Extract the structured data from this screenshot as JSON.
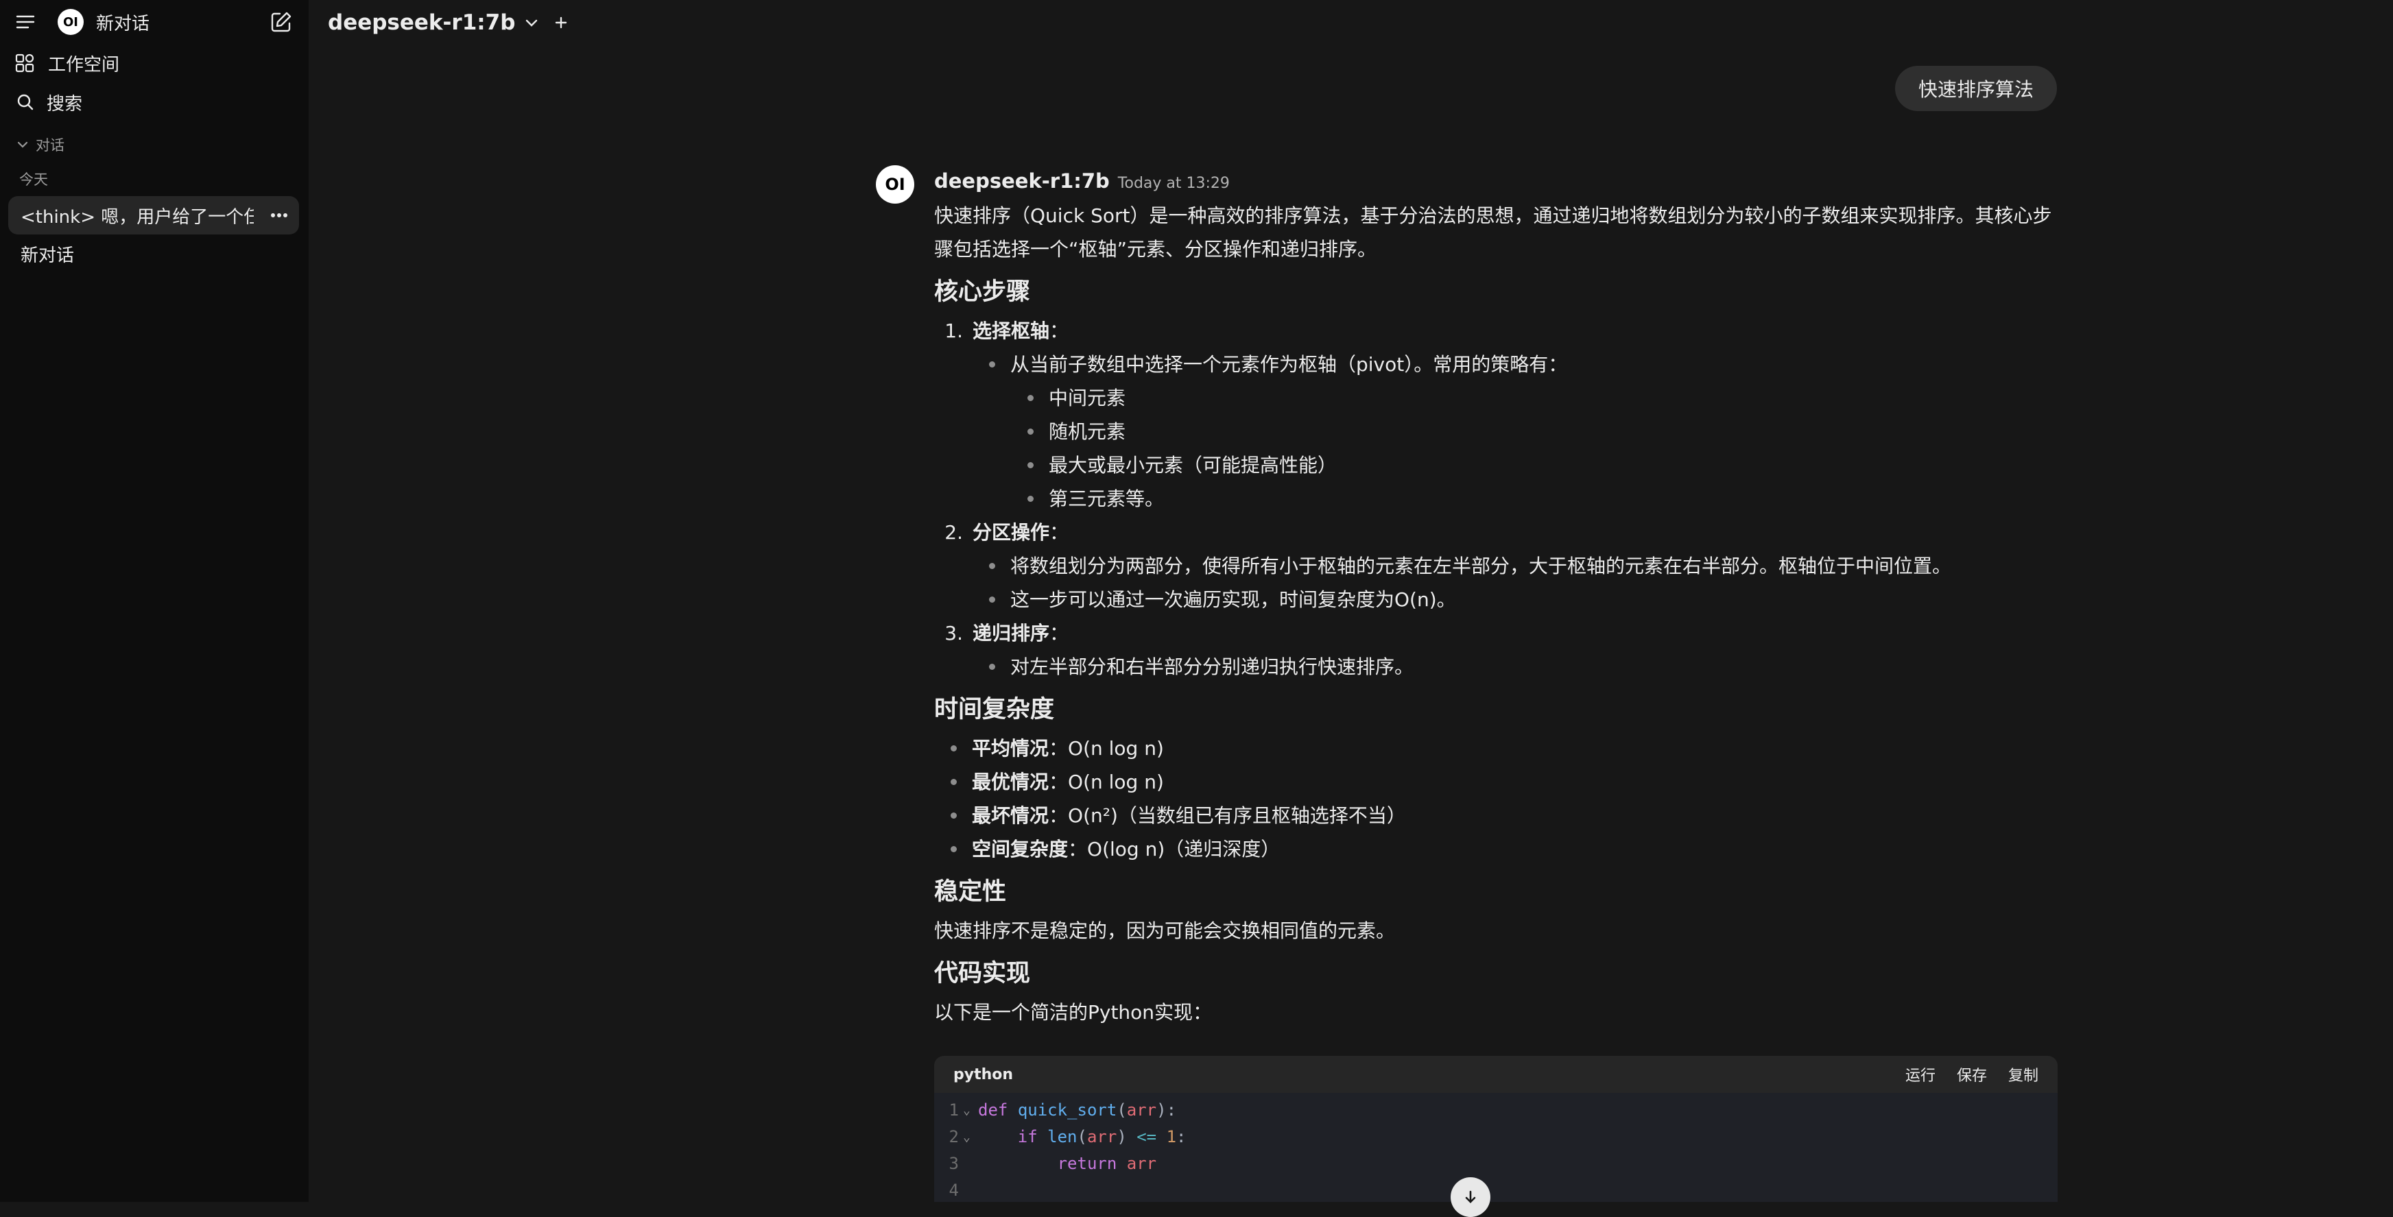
{
  "sidebar": {
    "new_chat": "新对话",
    "workspace": "工作空间",
    "search": "搜索",
    "section": "对话",
    "today": "今天",
    "chats": [
      {
        "label": "<think> 嗯，用户给了一个任务"
      },
      {
        "label": "新对话"
      }
    ],
    "logo_text": "OI"
  },
  "topbar": {
    "model": "deepseek-r1:7b"
  },
  "user_message": "快速排序算法",
  "assistant": {
    "avatar_text": "OI",
    "name": "deepseek-r1:7b",
    "time": "Today at 13:29",
    "intro1": "快速排序（Quick Sort）是一种高效的排序算法，基于分治法的思想，通过递归地将数组划分为较小的子数组来实现排序。其核心步",
    "intro2": "骤包括选择一个“枢轴”元素、分区操作和递归排序。",
    "h_core": "核心步骤",
    "step1_num": "1.",
    "step1_title": "选择枢轴",
    "step1_sub": "从当前子数组中选择一个元素作为枢轴（pivot）。常用的策略有：",
    "step1_opts": [
      "中间元素",
      "随机元素",
      "最大或最小元素（可能提高性能）",
      "第三元素等。"
    ],
    "step2_num": "2.",
    "step2_title": "分区操作",
    "step2_sub1": "将数组划分为两部分，使得所有小于枢轴的元素在左半部分，大于枢轴的元素在右半部分。枢轴位于中间位置。",
    "step2_sub2": "这一步可以通过一次遍历实现，时间复杂度为O(n)。",
    "step3_num": "3.",
    "step3_title": "递归排序",
    "step3_sub": "对左半部分和右半部分分别递归执行快速排序。",
    "h_time": "时间复杂度",
    "time_items": [
      {
        "label": "平均情况",
        "value": "O(n log n)"
      },
      {
        "label": "最优情况",
        "value": "O(n log n)"
      },
      {
        "label": "最坏情况",
        "value": "O(n²)（当数组已有序且枢轴选择不当）"
      },
      {
        "label": "空间复杂度",
        "value": "O(log n)（递归深度）"
      }
    ],
    "colon": "：",
    "h_stable": "稳定性",
    "stable_text": "快速排序不是稳定的，因为可能会交换相同值的元素。",
    "h_code": "代码实现",
    "code_intro": "以下是一个简洁的Python实现："
  },
  "code_block": {
    "lang": "python",
    "run": "运行",
    "save": "保存",
    "copy": "复制",
    "lines": [
      {
        "n": "1",
        "def": "def",
        "fn": "quick_sort",
        "arg": "arr"
      },
      {
        "n": "2",
        "kw": "if",
        "fn": "len",
        "arg": "arr",
        "op": "<=",
        "num": "1"
      },
      {
        "n": "3",
        "kw": "return",
        "arg": "arr"
      },
      {
        "n": "4"
      }
    ]
  },
  "colors": {
    "accent_bg": "#171717",
    "sidebar_bg": "#0d0d0d",
    "bubble": "#2f2f2f"
  }
}
